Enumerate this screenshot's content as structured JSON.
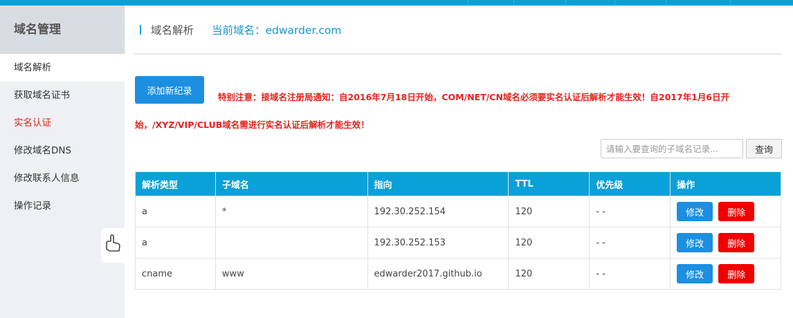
{
  "sidebar": {
    "title": "域名管理",
    "items": [
      {
        "label": "域名解析"
      },
      {
        "label": "获取域名证书"
      },
      {
        "label": "实名认证"
      },
      {
        "label": "修改域名DNS"
      },
      {
        "label": "修改联系人信息"
      },
      {
        "label": "操作记录"
      }
    ]
  },
  "header": {
    "title": "域名解析",
    "current_domain": "当前域名：edwarder.com"
  },
  "toolbar": {
    "add_label": "添加新纪录",
    "notice": "特别注意：接域名注册局通知：自2016年7月18日开始，COM/NET/CN域名必须要实名认证后解析才能生效！自2017年1月6日开始，/XYZ/VIP/CLUB域名需进行实名认证后解析才能生效！"
  },
  "search": {
    "placeholder": "请输入要查询的子域名记录...",
    "button_label": "查询"
  },
  "table": {
    "headers": [
      "解析类型",
      "子域名",
      "指向",
      "TTL",
      "优先级",
      "操作"
    ],
    "rows": [
      {
        "type": "a",
        "sub": "*",
        "target": "192.30.252.154",
        "ttl": "120",
        "priority": "- -",
        "edit": "修改",
        "delete": "删除"
      },
      {
        "type": "a",
        "sub": "",
        "target": "192.30.252.153",
        "ttl": "120",
        "priority": "- -",
        "edit": "修改",
        "delete": "删除"
      },
      {
        "type": "cname",
        "sub": "www",
        "target": "edwarder2017.github.io",
        "ttl": "120",
        "priority": "- -",
        "edit": "修改",
        "delete": "删除"
      }
    ]
  },
  "colors": {
    "accent": "#0aa0d8",
    "primary_button": "#1c8fe0",
    "danger": "#f00000",
    "notice": "#e4231d"
  }
}
